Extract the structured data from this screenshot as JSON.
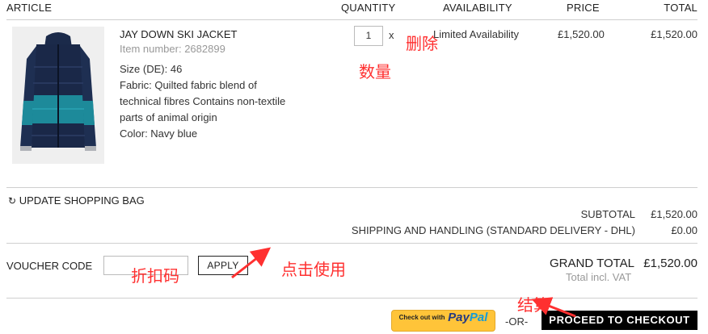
{
  "table_headers": {
    "article": "ARTICLE",
    "quantity": "QUANTITY",
    "availability": "AVAILABILITY",
    "price": "PRICE",
    "total": "TOTAL"
  },
  "item": {
    "name": "JAY DOWN SKI JACKET",
    "item_number": "Item number: 2682899",
    "size": "Size (DE): 46",
    "fabric_lines": [
      "Fabric: Quilted fabric blend of",
      "technical fibres Contains non-textile",
      "parts of animal origin"
    ],
    "color": "Color: Navy blue",
    "quantity": "1",
    "quantity_x": "x",
    "availability": "Limited Availability",
    "price": "£1,520.00",
    "total": "£1,520.00"
  },
  "update_bag_label": "UPDATE SHOPPING BAG",
  "summary": {
    "subtotal_label": "SUBTOTAL",
    "subtotal_value": "£1,520.00",
    "shipping_label": "SHIPPING AND HANDLING (STANDARD DELIVERY - DHL)",
    "shipping_value": "£0.00",
    "grand_total_label": "GRAND TOTAL",
    "grand_total_value": "£1,520.00",
    "total_incl_vat": "Total incl. VAT"
  },
  "voucher": {
    "label": "VOUCHER CODE",
    "value": "",
    "apply_label": "APPLY"
  },
  "checkout": {
    "paypal_small": "Check out with",
    "paypal_pay": "Pay",
    "paypal_pal": "Pal",
    "or_label": "-OR-",
    "proceed_label": "PROCEED TO CHECKOUT"
  },
  "annotations": {
    "delete": "删除",
    "quantity": "数量",
    "discount_code": "折扣码",
    "click_to_use": "点击使用",
    "checkout": "结算"
  },
  "colors": {
    "annotation": "#ff3030",
    "checkout_button": "#000000",
    "paypal_button": "#ffc439"
  }
}
